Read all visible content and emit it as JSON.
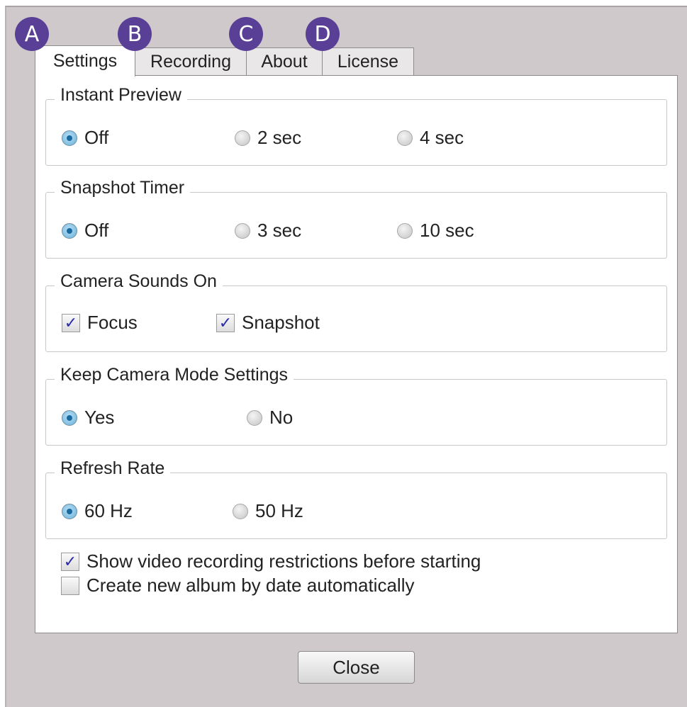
{
  "badges": [
    "A",
    "B",
    "C",
    "D"
  ],
  "tabs": [
    "Settings",
    "Recording",
    "About",
    "License"
  ],
  "instant_preview": {
    "title": "Instant Preview",
    "options": [
      "Off",
      "2 sec",
      "4 sec"
    ],
    "selected": "Off"
  },
  "snapshot_timer": {
    "title": "Snapshot Timer",
    "options": [
      "Off",
      "3 sec",
      "10 sec"
    ],
    "selected": "Off"
  },
  "camera_sounds": {
    "title": "Camera Sounds On",
    "focus": "Focus",
    "snapshot": "Snapshot",
    "focus_checked": true,
    "snapshot_checked": true
  },
  "keep_mode": {
    "title": "Keep Camera Mode Settings",
    "options": [
      "Yes",
      "No"
    ],
    "selected": "Yes"
  },
  "refresh_rate": {
    "title": "Refresh Rate",
    "options": [
      "60 Hz",
      "50 Hz"
    ],
    "selected": "60 Hz"
  },
  "show_restrictions": {
    "label": "Show video recording restrictions before starting",
    "checked": true
  },
  "create_album": {
    "label": "Create new album by date automatically",
    "checked": false
  },
  "close_label": "Close",
  "colors": {
    "badge": "#5a3f96",
    "window_bg": "#cfc9cc",
    "checkmark": "#2a2aa8"
  }
}
